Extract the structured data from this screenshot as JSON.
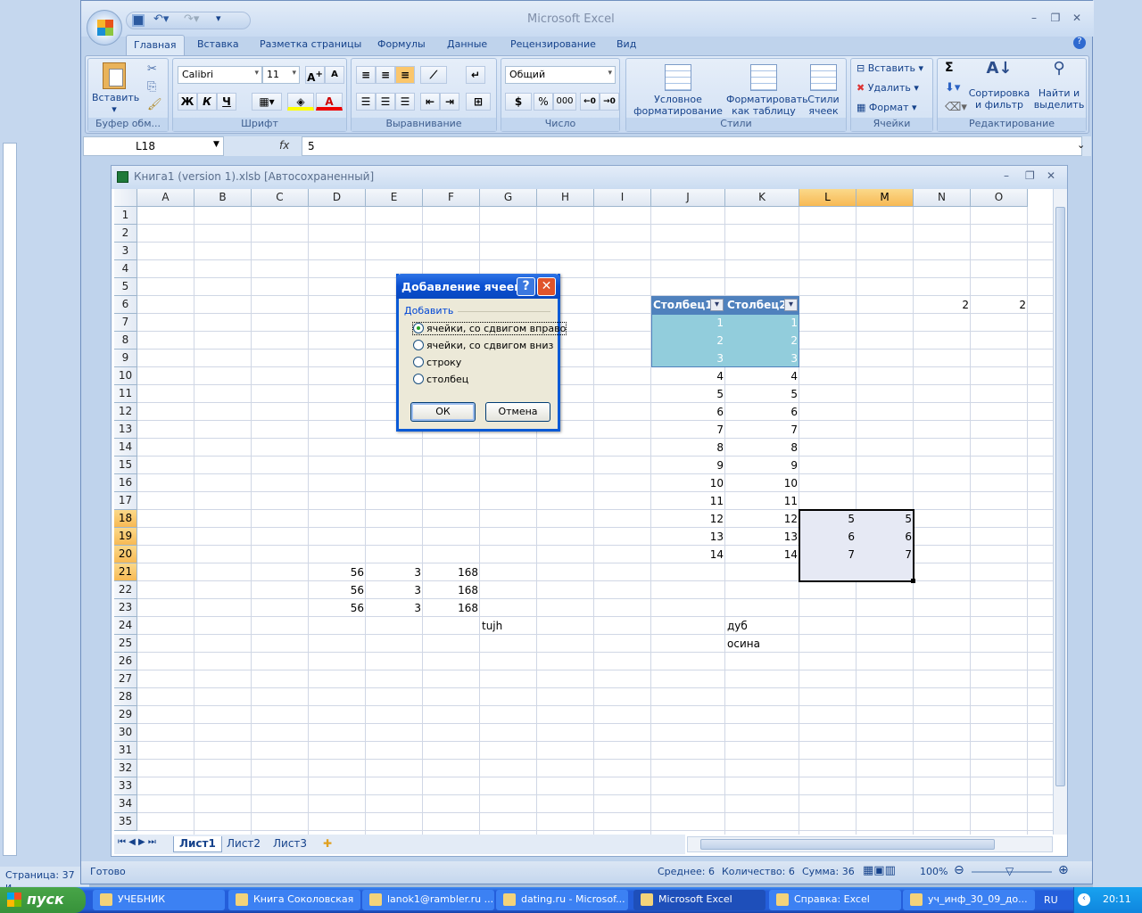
{
  "app_title": "Microsoft Excel",
  "bg_window": {
    "status": "Страница: 37 и..."
  },
  "tabs": [
    "Главная",
    "Вставка",
    "Разметка страницы",
    "Формулы",
    "Данные",
    "Рецензирование",
    "Вид"
  ],
  "ribbon": {
    "clipboard": {
      "label": "Буфер обм...",
      "paste": "Вставить"
    },
    "font": {
      "label": "Шрифт",
      "font_name": "Calibri",
      "font_size": "11",
      "bold": "Ж",
      "italic": "К",
      "underline": "Ч"
    },
    "alignment": {
      "label": "Выравнивание"
    },
    "number": {
      "label": "Число",
      "format": "Общий",
      "percent": "%",
      "thousands": "000"
    },
    "styles": {
      "label": "Стили",
      "cond": "Условное форматирование",
      "table": "Форматировать как таблицу",
      "cell": "Стили ячеек"
    },
    "cells": {
      "label": "Ячейки",
      "insert": "Вставить",
      "delete": "Удалить",
      "format": "Формат"
    },
    "editing": {
      "label": "Редактирование",
      "sort": "Сортировка и фильтр",
      "find": "Найти и выделить",
      "sum": "Σ"
    }
  },
  "formula_bar": {
    "name_box": "L18",
    "fx": "fx",
    "value": "5"
  },
  "workbook": {
    "title": "Книга1 (version 1).xlsb [Автосохраненный]"
  },
  "columns": [
    "A",
    "B",
    "C",
    "D",
    "E",
    "F",
    "G",
    "H",
    "I",
    "J",
    "K",
    "L",
    "M",
    "N",
    "O"
  ],
  "selected_columns": [
    "L",
    "M"
  ],
  "selected_rows": [
    18,
    19,
    20,
    21
  ],
  "rows": [
    1,
    2,
    3,
    4,
    5,
    6,
    7,
    8,
    9,
    10,
    11,
    12,
    13,
    14,
    15,
    16,
    17,
    18,
    19,
    20,
    21,
    22,
    23,
    24,
    25,
    26,
    27,
    28,
    29,
    30,
    31,
    32,
    33,
    34,
    35
  ],
  "cells": [
    {
      "ref": "J6",
      "v": "Столбец1",
      "t": "hdr"
    },
    {
      "ref": "K6",
      "v": "Столбец2",
      "t": "hdr"
    },
    {
      "ref": "N6",
      "v": "2"
    },
    {
      "ref": "O6",
      "v": "2"
    },
    {
      "ref": "J7",
      "v": "1",
      "t": "tbl"
    },
    {
      "ref": "K7",
      "v": "1",
      "t": "tbl"
    },
    {
      "ref": "J8",
      "v": "2",
      "t": "tbl"
    },
    {
      "ref": "K8",
      "v": "2",
      "t": "tbl"
    },
    {
      "ref": "J9",
      "v": "3",
      "t": "tbl"
    },
    {
      "ref": "K9",
      "v": "3",
      "t": "tbl"
    },
    {
      "ref": "J10",
      "v": "4"
    },
    {
      "ref": "K10",
      "v": "4"
    },
    {
      "ref": "J11",
      "v": "5"
    },
    {
      "ref": "K11",
      "v": "5"
    },
    {
      "ref": "J12",
      "v": "6"
    },
    {
      "ref": "K12",
      "v": "6"
    },
    {
      "ref": "J13",
      "v": "7"
    },
    {
      "ref": "K13",
      "v": "7"
    },
    {
      "ref": "J14",
      "v": "8"
    },
    {
      "ref": "K14",
      "v": "8"
    },
    {
      "ref": "J15",
      "v": "9"
    },
    {
      "ref": "K15",
      "v": "9"
    },
    {
      "ref": "J16",
      "v": "10"
    },
    {
      "ref": "K16",
      "v": "10"
    },
    {
      "ref": "J17",
      "v": "11"
    },
    {
      "ref": "K17",
      "v": "11"
    },
    {
      "ref": "J18",
      "v": "12"
    },
    {
      "ref": "K18",
      "v": "12"
    },
    {
      "ref": "J19",
      "v": "13"
    },
    {
      "ref": "K19",
      "v": "13"
    },
    {
      "ref": "J20",
      "v": "14"
    },
    {
      "ref": "K20",
      "v": "14"
    },
    {
      "ref": "L18",
      "v": "5"
    },
    {
      "ref": "M18",
      "v": "5"
    },
    {
      "ref": "L19",
      "v": "6"
    },
    {
      "ref": "M19",
      "v": "6"
    },
    {
      "ref": "L20",
      "v": "7"
    },
    {
      "ref": "M20",
      "v": "7"
    },
    {
      "ref": "D21",
      "v": "56"
    },
    {
      "ref": "E21",
      "v": "3"
    },
    {
      "ref": "F21",
      "v": "168"
    },
    {
      "ref": "D22",
      "v": "56"
    },
    {
      "ref": "E22",
      "v": "3"
    },
    {
      "ref": "F22",
      "v": "168"
    },
    {
      "ref": "D23",
      "v": "56"
    },
    {
      "ref": "E23",
      "v": "3"
    },
    {
      "ref": "F23",
      "v": "168"
    },
    {
      "ref": "G24",
      "v": "tujh",
      "t": "text"
    },
    {
      "ref": "K24",
      "v": "дуб",
      "t": "text"
    },
    {
      "ref": "K25",
      "v": "осина",
      "t": "text"
    }
  ],
  "sheet_tabs": [
    "Лист1",
    "Лист2",
    "Лист3"
  ],
  "status": {
    "ready": "Готово",
    "average": "Среднее: 6",
    "count": "Количество: 6",
    "sum": "Сумма: 36",
    "zoom": "100%"
  },
  "dialog": {
    "title": "Добавление ячеек",
    "group": "Добавить",
    "options": [
      "ячейки, со сдвигом вправо",
      "ячейки, со сдвигом вниз",
      "строку",
      "столбец"
    ],
    "selected": 0,
    "ok": "ОК",
    "cancel": "Отмена"
  },
  "taskbar": {
    "start": "пуск",
    "items": [
      "УЧЕБНИК",
      "Книга Соколовская",
      "lanok1@rambler.ru ...",
      "dating.ru - Microsof...",
      "Microsoft Excel",
      "Справка: Excel",
      "уч_инф_30_09_до..."
    ],
    "active": 4,
    "lang": "RU",
    "clock": "20:11"
  }
}
